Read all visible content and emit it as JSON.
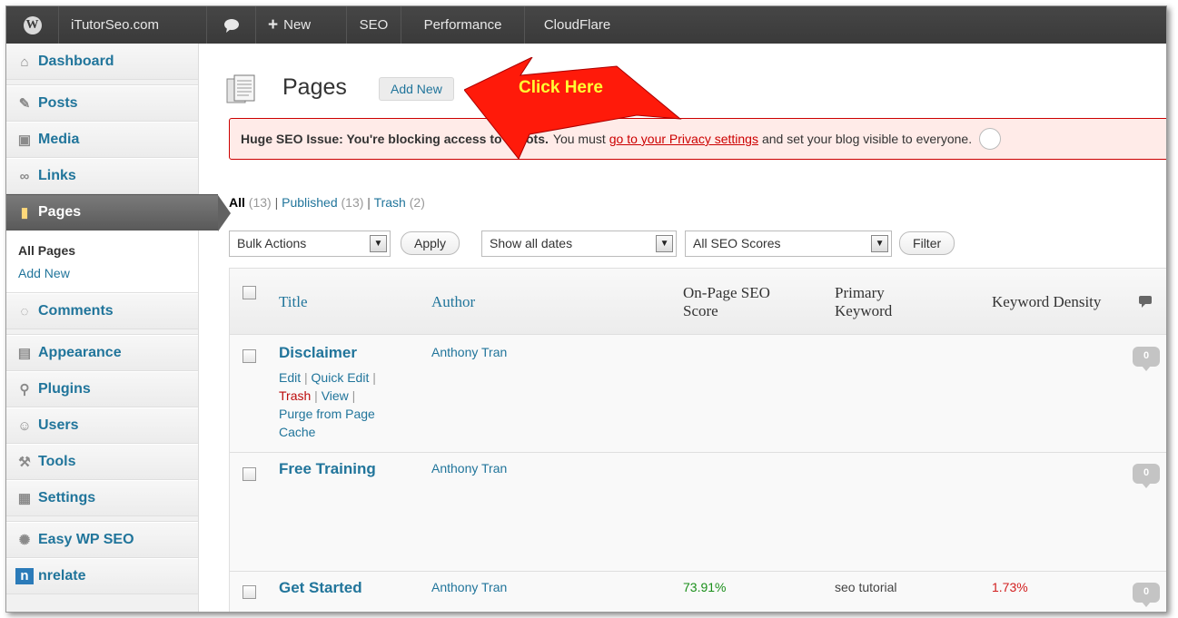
{
  "adminbar": {
    "site_name": "iTutorSeo.com",
    "new_label": "New",
    "menu": [
      "SEO",
      "Performance",
      "CloudFlare"
    ]
  },
  "sidebar": {
    "items": [
      {
        "label": "Dashboard",
        "icon": "dashboard-icon"
      },
      {
        "label": "Posts",
        "icon": "pin-icon"
      },
      {
        "label": "Media",
        "icon": "media-icon"
      },
      {
        "label": "Links",
        "icon": "links-icon"
      },
      {
        "label": "Pages",
        "icon": "pages-icon"
      },
      {
        "label": "Comments",
        "icon": "comments-icon"
      },
      {
        "label": "Appearance",
        "icon": "appearance-icon"
      },
      {
        "label": "Plugins",
        "icon": "plugins-icon"
      },
      {
        "label": "Users",
        "icon": "users-icon"
      },
      {
        "label": "Tools",
        "icon": "tools-icon"
      },
      {
        "label": "Settings",
        "icon": "settings-icon"
      },
      {
        "label": "Easy WP SEO",
        "icon": "easy-wp-seo-icon"
      },
      {
        "label": "nrelate",
        "icon": "nrelate-icon"
      }
    ],
    "submenu": [
      "All Pages",
      "Add New"
    ]
  },
  "header": {
    "title": "Pages",
    "add_new": "Add New",
    "annotation": "Click Here"
  },
  "notice": {
    "bold": "Huge SEO Issue: You're blocking access to robots.",
    "pre": "You must",
    "link": "go to your Privacy settings",
    "post": "and set your blog visible to everyone."
  },
  "filters": {
    "all": "All",
    "all_count": "(13)",
    "published": "Published",
    "published_count": "(13)",
    "trash": "Trash",
    "trash_count": "(2)"
  },
  "tablenav": {
    "bulk_actions": "Bulk Actions",
    "apply": "Apply",
    "dates": "Show all dates",
    "seo_scores": "All SEO Scores",
    "filter": "Filter"
  },
  "table": {
    "columns": {
      "title": "Title",
      "author": "Author",
      "score_l1": "On-Page SEO",
      "score_l2": "Score",
      "kw_l1": "Primary",
      "kw_l2": "Keyword",
      "density": "Keyword Density"
    },
    "rows": [
      {
        "title": "Disclaimer",
        "author": "Anthony Tran",
        "comments": "0",
        "score": "",
        "keyword": "",
        "density": ""
      },
      {
        "title": "Free Training",
        "author": "Anthony Tran",
        "comments": "0",
        "score": "",
        "keyword": "",
        "density": ""
      },
      {
        "title": "Get Started",
        "author": "Anthony Tran",
        "comments": "0",
        "score": "73.91%",
        "keyword": "seo tutorial",
        "density": "1.73%"
      }
    ],
    "row_actions": {
      "edit": "Edit",
      "quick_edit": "Quick Edit",
      "trash": "Trash",
      "view": "View",
      "purge": "Purge from Page Cache"
    }
  },
  "colors": {
    "admin_bar": "#464646",
    "link": "#21759b",
    "notice_border": "#cc0000",
    "arrow": "#ff0000",
    "score_good": "#1a8f1a",
    "density_bad": "#d21e1e"
  }
}
